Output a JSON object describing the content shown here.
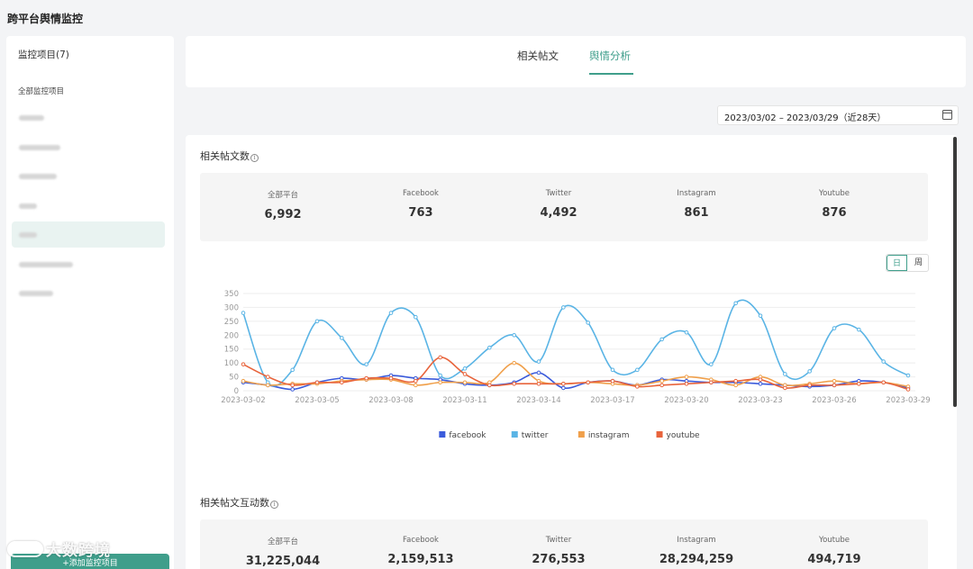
{
  "app_title": "跨平台舆情监控",
  "sidebar": {
    "header": "监控项目(7)",
    "group_label": "全部监控项目",
    "item_count": 7,
    "active_index": 4,
    "add_button_label": "+添加监控项目"
  },
  "tabs": [
    {
      "label": "相关帖文"
    },
    {
      "label": "舆情分析"
    }
  ],
  "active_tab": "舆情分析",
  "date_range": "2023/03/02 – 2023/03/29（近28天）",
  "posts_section": {
    "title": "相关帖文数",
    "stats": [
      {
        "label": "全部平台",
        "value": "6,992"
      },
      {
        "label": "Facebook",
        "value": "763"
      },
      {
        "label": "Twitter",
        "value": "4,492"
      },
      {
        "label": "Instagram",
        "value": "861"
      },
      {
        "label": "Youtube",
        "value": "876"
      }
    ],
    "period_toggle": {
      "day": "日",
      "week": "周",
      "selected": "日"
    }
  },
  "interaction_section": {
    "title": "相关帖文互动数",
    "stats": [
      {
        "label": "全部平台",
        "value": "31,225,044"
      },
      {
        "label": "Facebook",
        "value": "2,159,513"
      },
      {
        "label": "Twitter",
        "value": "276,553"
      },
      {
        "label": "Instagram",
        "value": "28,294,259"
      },
      {
        "label": "Youtube",
        "value": "494,719"
      }
    ]
  },
  "watermark": "大数跨境",
  "chart_data": {
    "type": "line",
    "x": [
      "2023-03-02",
      "2023-03-03",
      "2023-03-04",
      "2023-03-05",
      "2023-03-06",
      "2023-03-07",
      "2023-03-08",
      "2023-03-09",
      "2023-03-10",
      "2023-03-11",
      "2023-03-12",
      "2023-03-13",
      "2023-03-14",
      "2023-03-15",
      "2023-03-16",
      "2023-03-17",
      "2023-03-18",
      "2023-03-19",
      "2023-03-20",
      "2023-03-21",
      "2023-03-22",
      "2023-03-23",
      "2023-03-24",
      "2023-03-25",
      "2023-03-26",
      "2023-03-27",
      "2023-03-28",
      "2023-03-29"
    ],
    "x_tick_labels": [
      "2023-03-02",
      "2023-03-05",
      "2023-03-08",
      "2023-03-11",
      "2023-03-14",
      "2023-03-17",
      "2023-03-20",
      "2023-03-23",
      "2023-03-26",
      "2023-03-29"
    ],
    "ylim": [
      0,
      350
    ],
    "y_ticks": [
      0,
      50,
      100,
      150,
      200,
      250,
      300,
      350
    ],
    "grid": true,
    "legend_position": "bottom",
    "series": [
      {
        "name": "facebook",
        "color": "#3b5bdb",
        "values": [
          30,
          20,
          5,
          30,
          45,
          40,
          55,
          45,
          40,
          25,
          20,
          30,
          65,
          10,
          30,
          35,
          20,
          40,
          35,
          30,
          30,
          25,
          20,
          15,
          20,
          35,
          30,
          10
        ]
      },
      {
        "name": "twitter",
        "color": "#5ab4e5",
        "values": [
          280,
          30,
          75,
          250,
          190,
          95,
          280,
          265,
          55,
          80,
          155,
          200,
          105,
          300,
          245,
          75,
          75,
          185,
          210,
          95,
          315,
          270,
          60,
          70,
          225,
          220,
          105,
          55
        ]
      },
      {
        "name": "instagram",
        "color": "#f0a04b",
        "values": [
          35,
          20,
          25,
          25,
          35,
          40,
          40,
          20,
          30,
          30,
          30,
          100,
          35,
          25,
          30,
          25,
          20,
          35,
          50,
          40,
          20,
          50,
          20,
          25,
          35,
          25,
          30,
          15
        ]
      },
      {
        "name": "youtube",
        "color": "#e8643c",
        "values": [
          95,
          50,
          20,
          30,
          30,
          45,
          45,
          35,
          120,
          60,
          20,
          25,
          25,
          25,
          30,
          35,
          15,
          20,
          25,
          30,
          35,
          40,
          10,
          20,
          20,
          25,
          30,
          5
        ]
      }
    ]
  }
}
